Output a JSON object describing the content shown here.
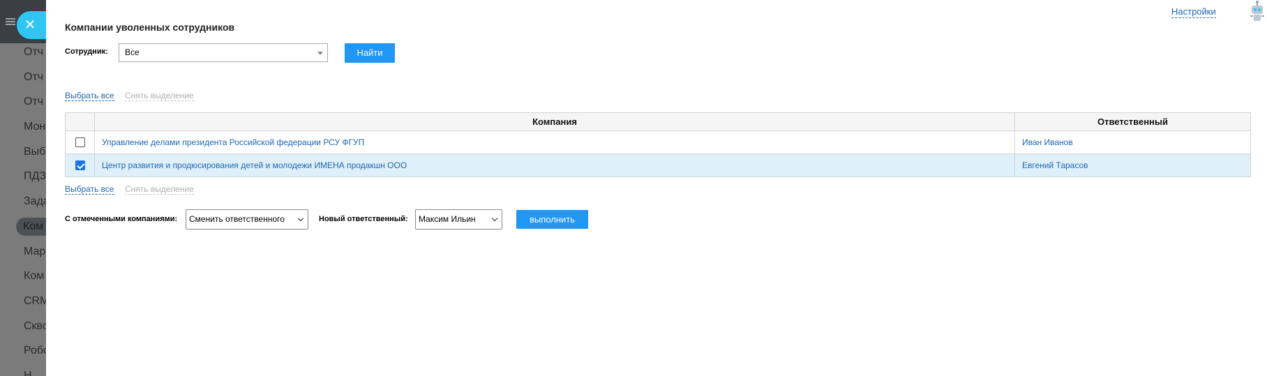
{
  "background_menu": {
    "items": [
      "Отч",
      "Отч",
      "Отч",
      "Мон",
      "Выб",
      "ПДЗ",
      "Зада",
      "Ком",
      "Мар",
      "Ком",
      "CRM",
      "Скво",
      "Робо",
      "Н"
    ],
    "active_index": 7
  },
  "header": {
    "settings_link": "Настройки",
    "robot_icon": "robot-icon",
    "close_icon": "close-icon"
  },
  "page": {
    "title": "Компании уволенных сотрудников"
  },
  "filter": {
    "employee_label": "Сотрудник:",
    "employee_value": "Все",
    "find_button": "Найти"
  },
  "selection_links": {
    "select_all": "Выбрать все",
    "deselect": "Снять выделение"
  },
  "table": {
    "columns": [
      "Компания",
      "Ответственный"
    ],
    "rows": [
      {
        "company": "Управление делами президента Российской федерации РСУ ФГУП",
        "responsible": "Иван Иванов",
        "checked": false
      },
      {
        "company": "Центр развития и продюсирования детей и молодежи ИМЕНА продакшн ООО",
        "responsible": "Евгений Тарасов",
        "checked": true
      }
    ]
  },
  "bulk_action": {
    "label": "С отмеченными компаниями:",
    "action_value": "Сменить ответственного",
    "new_responsible_label": "Новый ответственный:",
    "new_responsible_value": "Максим Ильин",
    "execute_button": "выполнить"
  },
  "colors": {
    "accent": "#2196f3",
    "link": "#2067b0",
    "selected_row": "#dff0fb",
    "close_button": "#2fc6f6"
  }
}
